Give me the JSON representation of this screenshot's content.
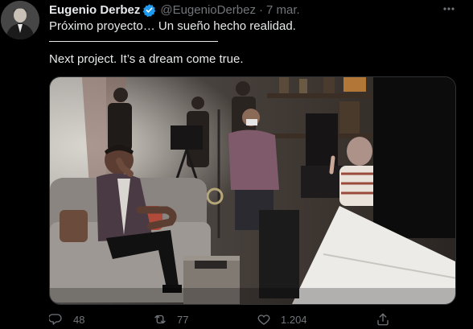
{
  "tweet": {
    "author_name": "Eugenio Derbez",
    "handle": "@EugenioDerbez",
    "separator": "·",
    "date": "7 mar.",
    "text_es": "Próximo proyecto… Un sueño hecho realidad.",
    "text_en": "Next project. It’s a dream come true."
  },
  "actions": {
    "reply_count": "48",
    "retweet_count": "77",
    "like_count": "1.204"
  },
  "colors": {
    "background": "#000000",
    "text": "#e7e9ea",
    "muted": "#71767b",
    "verified": "#1d9bf0"
  },
  "icons": [
    "verified-badge-icon",
    "more-icon",
    "reply-icon",
    "retweet-icon",
    "like-icon",
    "share-icon"
  ]
}
